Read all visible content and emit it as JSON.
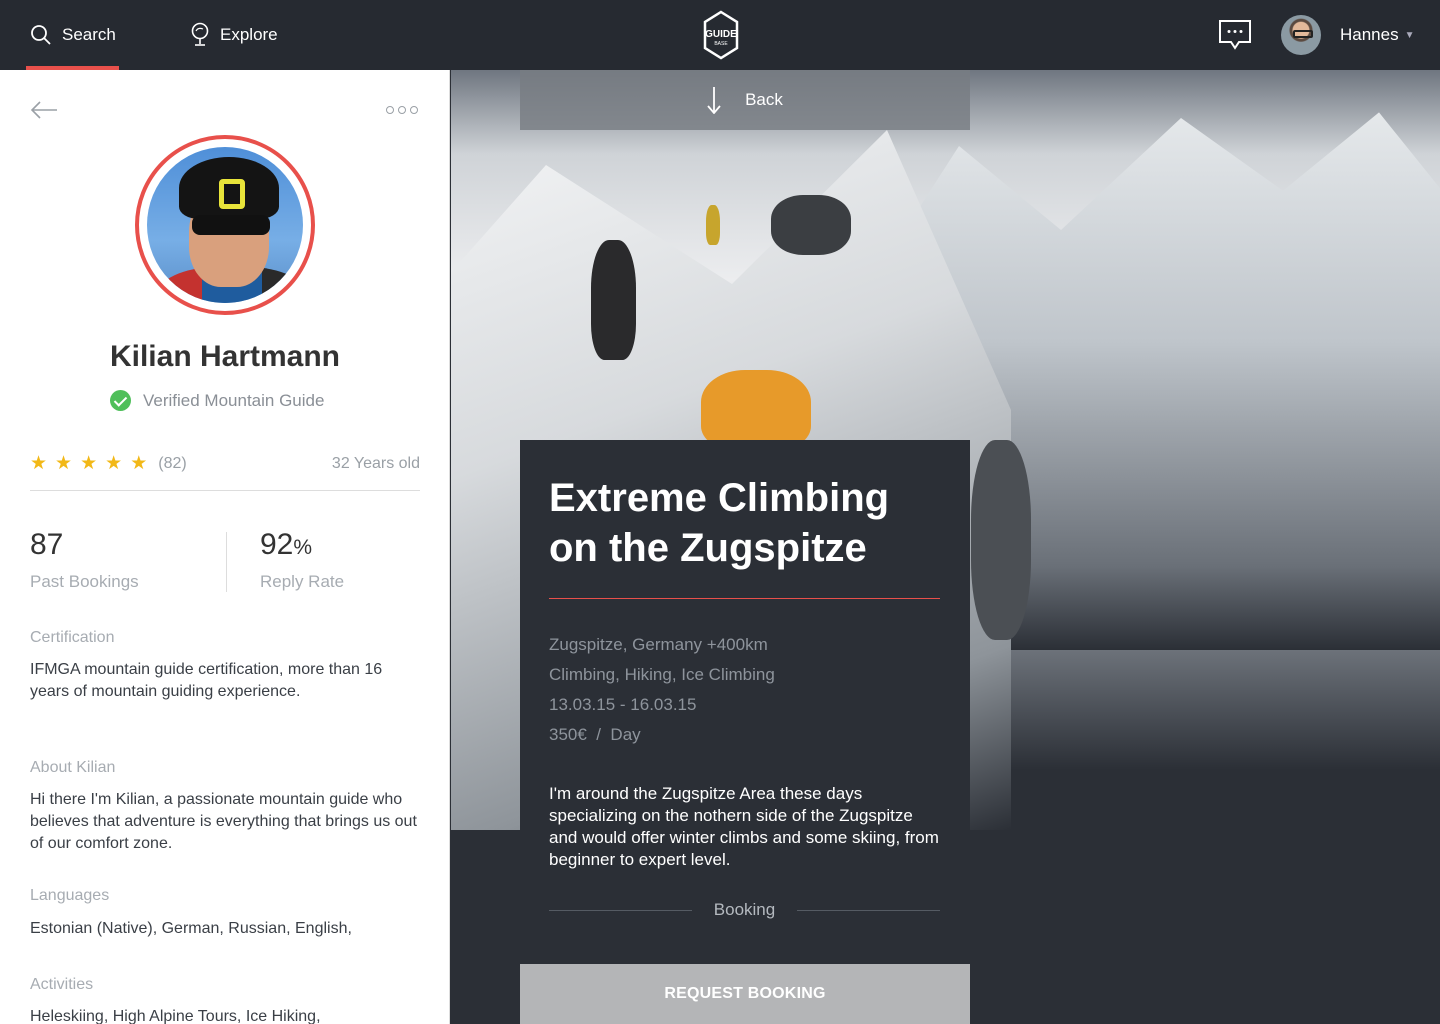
{
  "nav": {
    "search_label": "Search",
    "explore_label": "Explore",
    "logo_top": "GUIDE",
    "logo_bottom": "BASE",
    "user_name": "Hannes"
  },
  "profile": {
    "name": "Kilian Hartmann",
    "verified_label": "Verified Mountain Guide",
    "rating_stars": 5,
    "rating_count": "(82)",
    "age": "32 Years old",
    "stats": [
      {
        "value": "87",
        "suffix": "",
        "label": "Past Bookings"
      },
      {
        "value": "92",
        "suffix": "%",
        "label": "Reply Rate"
      }
    ],
    "sections": [
      {
        "title": "Certification",
        "body": "IFMGA mountain guide certification, more than 16 years of mountain guiding experience."
      },
      {
        "title": "About Kilian",
        "body": "Hi there I'm Kilian, a passionate mountain guide who believes that adventure is everything that brings us out of our comfort zone."
      },
      {
        "title": "Languages",
        "body": "Estonian (Native), German, Russian, English,"
      },
      {
        "title": "Activities",
        "body": "Heleskiing, High Alpine Tours, Ice Hiking,"
      }
    ]
  },
  "trip": {
    "back_label": "Back",
    "title_line1": "Extreme Climbing",
    "title_line2": "on the Zugspitze",
    "location": "Zugspitze, Germany +400km",
    "activities": "Climbing, Hiking, Ice Climbing",
    "dates": "13.03.15 - 16.03.15",
    "price": "350€  /  Day",
    "description": "I'm around the Zugspitze Area these days specializing on the nothern side of the Zugspitze and would offer winter climbs and some skiing, from beginner to expert level.",
    "booking_label": "Booking",
    "request_button": "REQUEST BOOKING"
  },
  "colors": {
    "accent": "#e8504b",
    "nav_bg": "#262a31",
    "card_bg": "#2b2f36",
    "verified": "#4fbf5a",
    "star": "#f2b817"
  },
  "icons": [
    "search-icon",
    "explore-icon",
    "logo",
    "message-icon",
    "back-arrow-icon",
    "more-icon",
    "check-icon",
    "star-icon",
    "down-arrow-icon"
  ]
}
